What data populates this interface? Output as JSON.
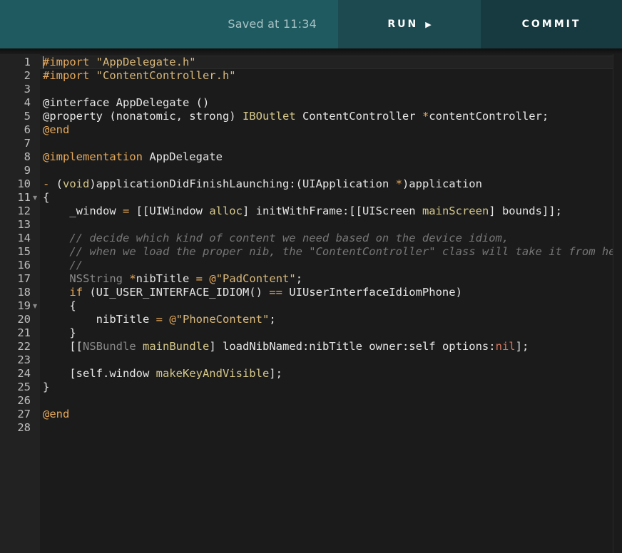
{
  "toolbar": {
    "saved_text": "Saved at 11:34",
    "run_label": "RUN",
    "run_icon": "▶",
    "commit_label": "COMMIT"
  },
  "editor": {
    "line_numbers": [
      "1",
      "2",
      "3",
      "4",
      "5",
      "6",
      "7",
      "8",
      "9",
      "10",
      "11",
      "12",
      "13",
      "14",
      "15",
      "16",
      "17",
      "18",
      "19",
      "20",
      "21",
      "22",
      "23",
      "24",
      "25",
      "26",
      "27",
      "28"
    ],
    "lines": [
      [
        [
          "m",
          "#import "
        ],
        [
          "s",
          "\"AppDelegate.h\""
        ]
      ],
      [
        [
          "m",
          "#import "
        ],
        [
          "s",
          "\"ContentController.h\""
        ]
      ],
      [],
      [
        [
          "p",
          "@interface AppDelegate ()"
        ]
      ],
      [
        [
          "p",
          "@property (nonatomic, strong) "
        ],
        [
          "c",
          "IBOutlet"
        ],
        [
          "p",
          " ContentController "
        ],
        [
          "o",
          "*"
        ],
        [
          "p",
          "contentController;"
        ]
      ],
      [
        [
          "k",
          "@end"
        ]
      ],
      [],
      [
        [
          "k",
          "@implementation"
        ],
        [
          "p",
          " AppDelegate"
        ]
      ],
      [],
      [
        [
          "o",
          "- "
        ],
        [
          "p",
          "("
        ],
        [
          "c",
          "void"
        ],
        [
          "p",
          ")applicationDidFinishLaunching:(UIApplication "
        ],
        [
          "o",
          "*"
        ],
        [
          "p",
          ")application"
        ]
      ],
      [
        [
          "p",
          "{"
        ]
      ],
      [
        [
          "p",
          "    _window "
        ],
        [
          "o",
          "="
        ],
        [
          "p",
          " [[UIWindow "
        ],
        [
          "c",
          "alloc"
        ],
        [
          "p",
          "] initWithFrame:[[UIScreen "
        ],
        [
          "c",
          "mainScreen"
        ],
        [
          "p",
          "] bounds]];"
        ]
      ],
      [],
      [
        [
          "t",
          "    // decide which kind of content we need based on the device idiom,"
        ]
      ],
      [
        [
          "t",
          "    // when we load the proper nib, the \"ContentController\" class will take it from here"
        ]
      ],
      [
        [
          "t",
          "    //"
        ]
      ],
      [
        [
          "p",
          "    "
        ],
        [
          "y",
          "NSString"
        ],
        [
          "p",
          " "
        ],
        [
          "o",
          "*"
        ],
        [
          "p",
          "nibTitle "
        ],
        [
          "o",
          "="
        ],
        [
          "p",
          " "
        ],
        [
          "o",
          "@"
        ],
        [
          "s",
          "\"PadContent\""
        ],
        [
          "p",
          ";"
        ]
      ],
      [
        [
          "p",
          "    "
        ],
        [
          "k",
          "if"
        ],
        [
          "p",
          " (UI_USER_INTERFACE_IDIOM() "
        ],
        [
          "o",
          "=="
        ],
        [
          "p",
          " UIUserInterfaceIdiomPhone)"
        ]
      ],
      [
        [
          "p",
          "    {"
        ]
      ],
      [
        [
          "p",
          "        nibTitle "
        ],
        [
          "o",
          "="
        ],
        [
          "p",
          " "
        ],
        [
          "o",
          "@"
        ],
        [
          "s",
          "\"PhoneContent\""
        ],
        [
          "p",
          ";"
        ]
      ],
      [
        [
          "p",
          "    }"
        ]
      ],
      [
        [
          "p",
          "    [["
        ],
        [
          "y",
          "NSBundle"
        ],
        [
          "p",
          " "
        ],
        [
          "c",
          "mainBundle"
        ],
        [
          "p",
          "] loadNibNamed:nibTitle owner:self options:"
        ],
        [
          "n",
          "nil"
        ],
        [
          "p",
          "];"
        ]
      ],
      [],
      [
        [
          "p",
          "    [self.window "
        ],
        [
          "c",
          "makeKeyAndVisible"
        ],
        [
          "p",
          "];"
        ]
      ],
      [
        [
          "p",
          "}"
        ]
      ],
      [],
      [
        [
          "k",
          "@end"
        ]
      ],
      []
    ],
    "fold_markers": [
      "11",
      "19"
    ]
  },
  "colors": {
    "toolbar_bg": "#1f5a60",
    "run_bg": "#1d4a50",
    "commit_bg": "#163a3f",
    "editor_bg": "#1b1b1b",
    "string": "#d9b87a",
    "keyword": "#e6a95b",
    "comment": "#767676",
    "nil": "#d4755e"
  }
}
